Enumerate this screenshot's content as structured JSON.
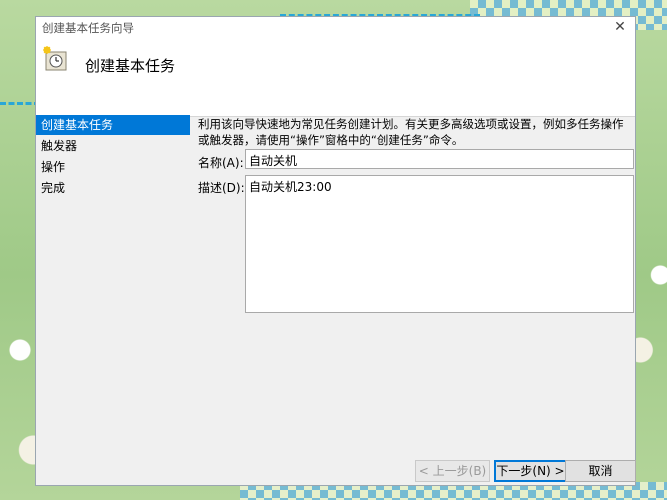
{
  "window": {
    "title": "创建基本任务向导",
    "close_glyph": "✕"
  },
  "header": {
    "title": "创建基本任务"
  },
  "sidebar": {
    "items": [
      {
        "label": "创建基本任务"
      },
      {
        "label": "触发器"
      },
      {
        "label": "操作"
      },
      {
        "label": "完成"
      }
    ],
    "active_index": 0
  },
  "main": {
    "description": "利用该向导快速地为常见任务创建计划。有关更多高级选项或设置，例如多任务操作或触发器，请使用“操作”窗格中的“创建任务”命令。",
    "name_label": "名称(A):",
    "name_value": "自动关机",
    "desc_label": "描述(D):",
    "desc_value": "自动关机23:00"
  },
  "footer": {
    "back_label": "< 上一步(B)",
    "next_label": "下一步(N) >",
    "cancel_label": "取消"
  },
  "colors": {
    "accent": "#0078d7"
  }
}
